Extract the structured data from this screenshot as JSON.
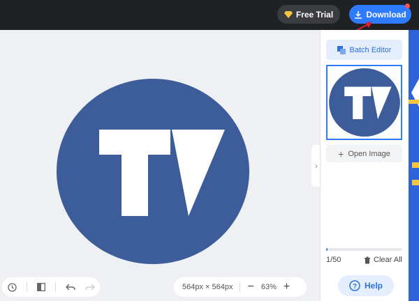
{
  "topbar": {
    "free_trial_label": "Free Trial",
    "download_label": "Download"
  },
  "sidebar": {
    "batch_editor_label": "Batch Editor",
    "open_image_label": "Open Image",
    "image_count": "1/50",
    "clear_all_label": "Clear All",
    "help_label": "Help",
    "progress_fraction": 0.02
  },
  "canvas": {
    "dimensions": "564px × 564px",
    "zoom": "63%"
  },
  "colors": {
    "logo_blue": "#3d5d9a",
    "accent": "#2f7bff",
    "topbar": "#1f2124"
  },
  "icons": [
    "gem-icon",
    "download-icon",
    "batch-icon",
    "plus-icon",
    "trash-icon",
    "help-icon",
    "history-icon",
    "compare-icon",
    "undo-icon",
    "redo-icon",
    "minus-icon",
    "chevron-right-icon"
  ]
}
